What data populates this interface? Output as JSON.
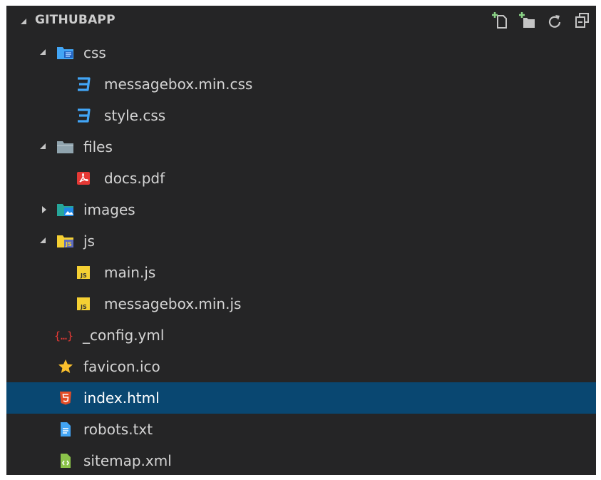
{
  "explorer": {
    "title": "GITHUBAPP",
    "actions": [
      {
        "name": "new-file",
        "icon": "new-file-icon"
      },
      {
        "name": "new-folder",
        "icon": "new-folder-icon"
      },
      {
        "name": "refresh",
        "icon": "refresh-icon"
      },
      {
        "name": "collapse-all",
        "icon": "collapse-all-icon"
      }
    ]
  },
  "tree": [
    {
      "label": "css",
      "type": "folder",
      "expanded": true,
      "icon": "css-folder-icon"
    },
    {
      "label": "messagebox.min.css",
      "type": "file",
      "icon": "css-file-icon"
    },
    {
      "label": "style.css",
      "type": "file",
      "icon": "css-file-icon"
    },
    {
      "label": "files",
      "type": "folder",
      "expanded": true,
      "icon": "folder-icon"
    },
    {
      "label": "docs.pdf",
      "type": "file",
      "icon": "pdf-file-icon"
    },
    {
      "label": "images",
      "type": "folder",
      "expanded": false,
      "icon": "images-folder-icon"
    },
    {
      "label": "js",
      "type": "folder",
      "expanded": true,
      "icon": "js-folder-icon"
    },
    {
      "label": "main.js",
      "type": "file",
      "icon": "js-file-icon"
    },
    {
      "label": "messagebox.min.js",
      "type": "file",
      "icon": "js-file-icon"
    },
    {
      "label": "_config.yml",
      "type": "file",
      "icon": "yaml-file-icon"
    },
    {
      "label": "favicon.ico",
      "type": "file",
      "icon": "favicon-star-icon"
    },
    {
      "label": "index.html",
      "type": "file",
      "icon": "html-file-icon",
      "selected": true
    },
    {
      "label": "robots.txt",
      "type": "file",
      "icon": "text-file-icon"
    },
    {
      "label": "sitemap.xml",
      "type": "file",
      "icon": "xml-file-icon"
    }
  ],
  "colors": {
    "background": "#252526",
    "selection": "#094771",
    "css_blue": "#42a5f5",
    "pdf_red": "#e53935",
    "js_yellow": "#f5d033",
    "html_orange": "#e44d26",
    "xml_green": "#8bc34a",
    "star_yellow": "#fbc02d"
  }
}
